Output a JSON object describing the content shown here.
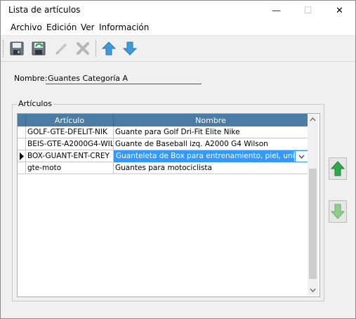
{
  "window": {
    "title": "Lista de artículos",
    "minimize_glyph": "—",
    "maximize_glyph": "☐",
    "close_glyph": "✕"
  },
  "menu": [
    "Archivo",
    "Edición",
    "Ver",
    "Información"
  ],
  "toolbar": {
    "buttons": [
      "save-icon",
      "save-reload-icon",
      "edit-icon",
      "delete-icon",
      "arrow-up-icon",
      "arrow-down-icon"
    ]
  },
  "form": {
    "name_label": "Nombre:",
    "name_value": "Guantes Categoría A"
  },
  "articles": {
    "group_title": "Artículos",
    "columns": [
      "Artículo",
      "Nombre"
    ],
    "rows": [
      {
        "articulo": "GOLF-GTE-DFELIT-NIK",
        "nombre": "Guante para Golf Dri-Fit Elite Nike"
      },
      {
        "articulo": "BEIS-GTE-A2000G4-WIL",
        "nombre": "Guante de Baseball izq. A2000 G4 Wilson"
      },
      {
        "articulo": "BOX-GUANT-ENT-CREY",
        "nombre": "Guanteleta de Box para entrenamiento, piel, unitalla"
      },
      {
        "articulo": "gte-moto",
        "nombre": "Guantes para motociclista"
      }
    ],
    "selected_row": 2
  },
  "colors": {
    "header": "#4a7ca6",
    "selection": "#3399ff",
    "arrow_green": "#2ea84a"
  }
}
